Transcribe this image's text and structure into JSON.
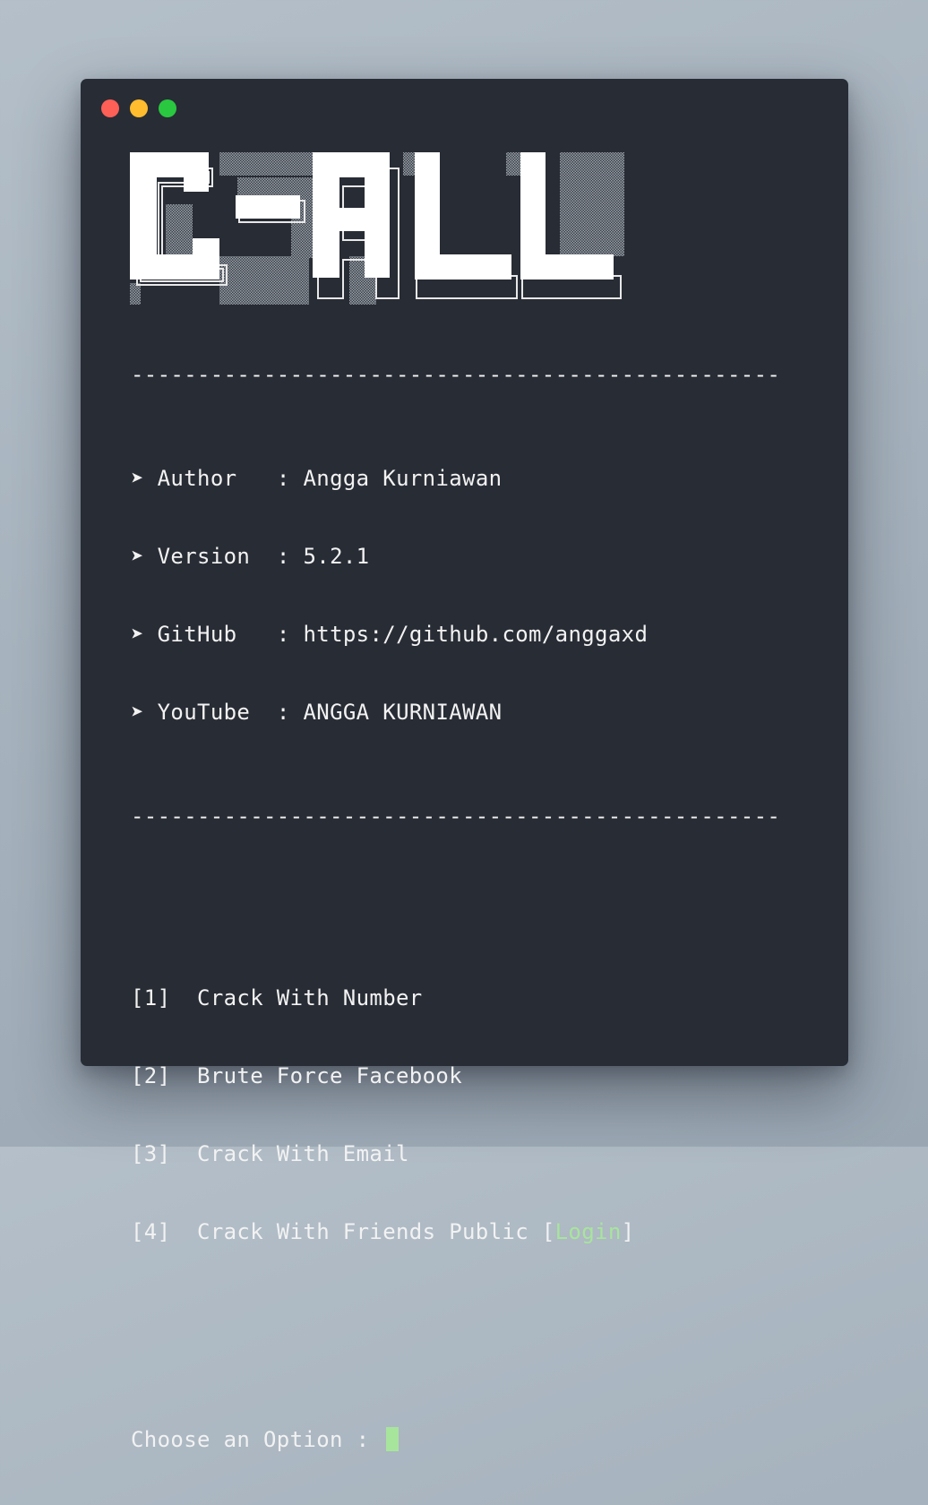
{
  "window": {
    "controls": [
      "close",
      "minimize",
      "maximize"
    ]
  },
  "banner": {
    "text": "C-ALL"
  },
  "divider": "-------------------------------------------------",
  "info": [
    {
      "arrow": "➤",
      "key": "Author  ",
      "sep": ":",
      "value": "Angga Kurniawan"
    },
    {
      "arrow": "➤",
      "key": "Version ",
      "sep": ":",
      "value": "5.2.1"
    },
    {
      "arrow": "➤",
      "key": "GitHub  ",
      "sep": ":",
      "value": "https://github.com/anggaxd"
    },
    {
      "arrow": "➤",
      "key": "YouTube ",
      "sep": ":",
      "value": "ANGGA KURNIAWAN"
    }
  ],
  "menu": [
    {
      "index": "[1]",
      "label": "Crack With Number"
    },
    {
      "index": "[2]",
      "label": "Brute Force Facebook"
    },
    {
      "index": "[3]",
      "label": "Crack With Email"
    },
    {
      "index": "[4]",
      "label": "Crack With Friends Public",
      "open": "[",
      "tag": "Login",
      "close": "]"
    }
  ],
  "prompt": {
    "label": "Choose an Option :"
  },
  "colors": {
    "background": "#282c35",
    "text": "#f2f2f2",
    "accent": "#a8e59c",
    "close": "#fe5f57",
    "minimize": "#febc2e",
    "maximize": "#29c840"
  }
}
